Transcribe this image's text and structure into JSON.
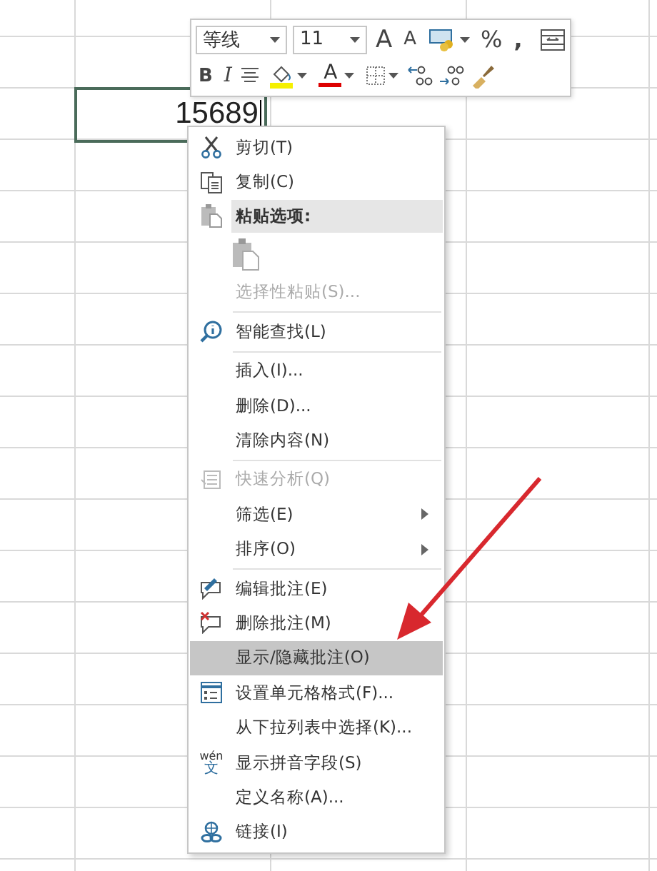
{
  "cell": {
    "value": "15689",
    "editing": true
  },
  "toolbar": {
    "font": "等线",
    "size": "11",
    "grow_font": "A",
    "shrink_font": "A",
    "percent": "%",
    "comma": ",",
    "bold": "B",
    "italic": "I",
    "font_color": "A"
  },
  "menu": {
    "items": [
      {
        "kind": "item",
        "label": "剪切(T)",
        "disabled": false,
        "submenu": false,
        "selected": false
      },
      {
        "kind": "item",
        "label": "复制(C)",
        "disabled": false,
        "submenu": false,
        "selected": false
      },
      {
        "kind": "header",
        "label": "粘贴选项:"
      },
      {
        "kind": "paste-options"
      },
      {
        "kind": "item",
        "label": "选择性粘贴(S)...",
        "disabled": true,
        "submenu": false,
        "selected": false
      },
      {
        "kind": "separator"
      },
      {
        "kind": "item",
        "label": "智能查找(L)",
        "disabled": false,
        "submenu": false,
        "selected": false
      },
      {
        "kind": "separator"
      },
      {
        "kind": "item",
        "label": "插入(I)...",
        "disabled": false,
        "submenu": false,
        "selected": false
      },
      {
        "kind": "item",
        "label": "删除(D)...",
        "disabled": false,
        "submenu": false,
        "selected": false
      },
      {
        "kind": "item",
        "label": "清除内容(N)",
        "disabled": false,
        "submenu": false,
        "selected": false
      },
      {
        "kind": "separator"
      },
      {
        "kind": "item",
        "label": "快速分析(Q)",
        "disabled": true,
        "submenu": false,
        "selected": false
      },
      {
        "kind": "item",
        "label": "筛选(E)",
        "disabled": false,
        "submenu": true,
        "selected": false
      },
      {
        "kind": "item",
        "label": "排序(O)",
        "disabled": false,
        "submenu": true,
        "selected": false
      },
      {
        "kind": "separator"
      },
      {
        "kind": "item",
        "label": "编辑批注(E)",
        "disabled": false,
        "submenu": false,
        "selected": false
      },
      {
        "kind": "item",
        "label": "删除批注(M)",
        "disabled": false,
        "submenu": false,
        "selected": false
      },
      {
        "kind": "item",
        "label": "显示/隐藏批注(O)",
        "disabled": false,
        "submenu": false,
        "selected": true
      },
      {
        "kind": "item",
        "label": "设置单元格格式(F)...",
        "disabled": false,
        "submenu": false,
        "selected": false
      },
      {
        "kind": "item",
        "label": "从下拉列表中选择(K)...",
        "disabled": false,
        "submenu": false,
        "selected": false
      },
      {
        "kind": "item",
        "icon_top": "wén",
        "icon_bottom": "文",
        "label": "显示拼音字段(S)",
        "disabled": false,
        "submenu": false,
        "selected": false
      },
      {
        "kind": "item",
        "label": "定义名称(A)...",
        "disabled": false,
        "submenu": false,
        "selected": false
      },
      {
        "kind": "item",
        "label": "链接(I)",
        "disabled": false,
        "submenu": false,
        "selected": false
      }
    ]
  }
}
